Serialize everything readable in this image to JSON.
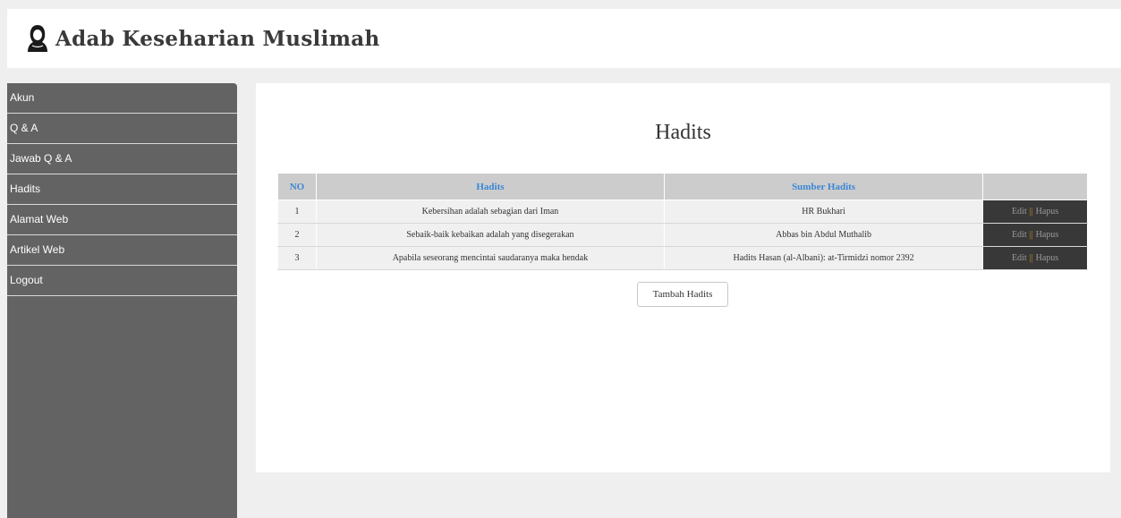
{
  "header": {
    "title": "Adab Keseharian Muslimah",
    "logo_icon": "hijab-woman-icon"
  },
  "sidebar": {
    "items": [
      {
        "label": "Akun"
      },
      {
        "label": "Q & A"
      },
      {
        "label": "Jawab Q & A"
      },
      {
        "label": "Hadits"
      },
      {
        "label": "Alamat Web"
      },
      {
        "label": "Artikel Web"
      },
      {
        "label": "Logout"
      }
    ]
  },
  "main": {
    "title": "Hadits",
    "table": {
      "headers": {
        "no": "NO",
        "hadits": "Hadits",
        "sumber": "Sumber Hadits",
        "action": ""
      },
      "rows": [
        {
          "no": "1",
          "hadits": "Kebersihan adalah sebagian dari Iman",
          "sumber": "HR Bukhari"
        },
        {
          "no": "2",
          "hadits": "Sebaik-baik kebaikan adalah yang disegerakan",
          "sumber": "Abbas bin Abdul Muthalib"
        },
        {
          "no": "3",
          "hadits": "Apabila seseorang mencintai saudaranya maka hendak",
          "sumber": "Hadits Hasan (al-Albani): at-Tirmidzi nomor 2392"
        }
      ],
      "action_edit": "Edit",
      "action_separator": "||",
      "action_delete": "Hapus"
    },
    "add_button": "Tambah Hadits"
  },
  "colors": {
    "sidebar_bg": "#636363",
    "header_text": "#3b87d6",
    "action_bg": "#383838"
  }
}
